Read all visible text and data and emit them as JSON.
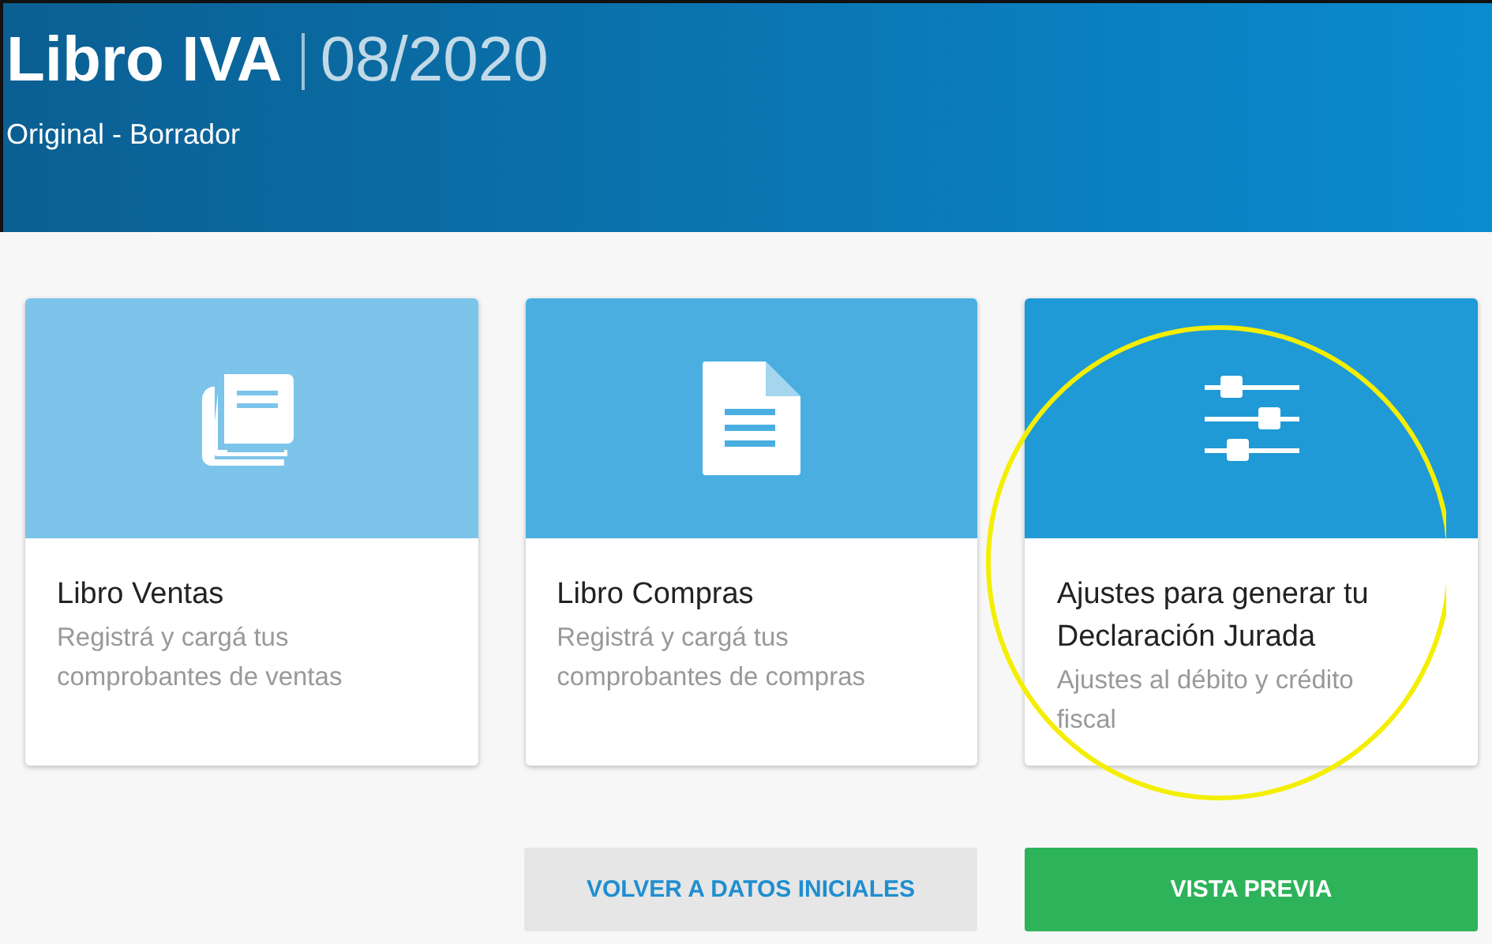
{
  "header": {
    "title": "Libro IVA",
    "period": "08/2020",
    "subtitle": "Original - Borrador"
  },
  "cards": [
    {
      "kind": "book",
      "title": "Libro Ventas",
      "description": "Registrá y cargá tus comprobantes de ventas",
      "color": "#7cc4ea"
    },
    {
      "kind": "document",
      "title": "Libro Compras",
      "description": "Registrá y cargá tus comprobantes de compras",
      "color": "#4aafe0"
    },
    {
      "kind": "sliders",
      "title": "Ajustes para generar tu Declaración Jurada",
      "description": "Ajustes al débito y crédito fiscal",
      "color": "#1f9ad6"
    }
  ],
  "buttons": [
    {
      "kind": "secondary",
      "label": "VOLVER A DATOS INICIALES"
    },
    {
      "kind": "primary",
      "label": "VISTA PREVIA"
    }
  ]
}
